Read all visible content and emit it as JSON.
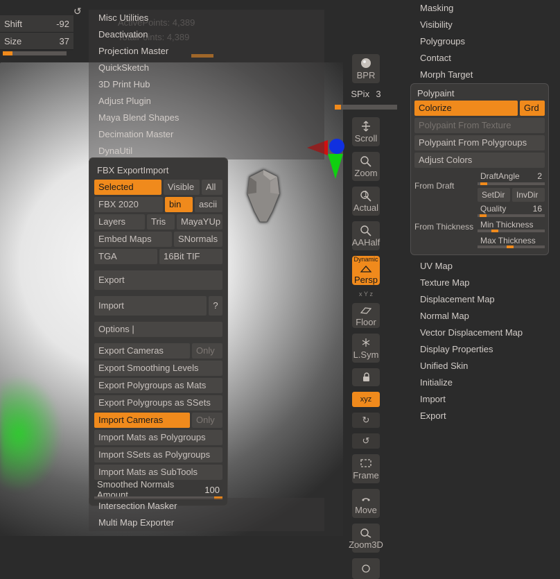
{
  "topleft": {
    "shift_label": "Shift",
    "shift_value": "-92",
    "size_label": "Size",
    "size_value": "37"
  },
  "stats": {
    "active_label": "ActivePoints:",
    "active_value": "4,389",
    "total_label": "TotalPoints:",
    "total_value": "4,389"
  },
  "plugins": {
    "misc": "Misc Utilities",
    "deact": "Deactivation",
    "proj": "Projection Master",
    "qs": "QuickSketch",
    "p3d": "3D Print Hub",
    "adj": "Adjust Plugin",
    "maya": "Maya Blend Shapes",
    "dec": "Decimation Master",
    "dyna": "DynaUtil",
    "fbx_title": "FBX ExportImport",
    "inter": "Intersection Masker",
    "mme": "Multi Map Exporter"
  },
  "fbx": {
    "selected": "Selected",
    "visible": "Visible",
    "all": "All",
    "ver": "FBX 2020",
    "bin": "bin",
    "ascii": "ascii",
    "layers": "Layers",
    "tris": "Tris",
    "mayayup": "MayaYUp",
    "embed": "Embed Maps",
    "snorm": "SNormals",
    "tga": "TGA",
    "tif": "16Bit TIF",
    "export": "Export",
    "import": "Import",
    "qmark": "?",
    "opts": "Options  |",
    "expcam": "Export Cameras",
    "only1": "Only",
    "expsl": "Export Smoothing Levels",
    "exppg": "Export Polygroups as Mats",
    "expss": "Export Polygroups as SSets",
    "impcam": "Import Cameras",
    "only2": "Only",
    "impmat": "Import Mats as Polygroups",
    "impss": "Import SSets as Polygroups",
    "impsub": "Import Mats as SubTools",
    "snamt_label": "Smoothed Normals Amount",
    "snamt_val": "100"
  },
  "svr": {
    "bpr": "BPR",
    "spix": "SPix",
    "spix_val": "3",
    "scroll": "Scroll",
    "zoom": "Zoom",
    "actual": "Actual",
    "aahalf": "AAHalf",
    "dynamic": "Dynamic",
    "persp": "Persp",
    "floor": "Floor",
    "lsym": "L.Sym",
    "xyz": "xyz",
    "frame": "Frame",
    "move": "Move",
    "zoom3d": "Zoom3D"
  },
  "right": {
    "masking": "Masking",
    "visibility": "Visibility",
    "polygroups": "Polygroups",
    "contact": "Contact",
    "morph": "Morph Target",
    "polypaint": "Polypaint",
    "colorize": "Colorize",
    "grd": "Grd",
    "pftex": "Polypaint From Texture",
    "pfpg": "Polypaint From Polygroups",
    "adjcol": "Adjust Colors",
    "from_draft": "From Draft",
    "draft_angle": "DraftAngle",
    "draft_angle_val": "2",
    "setdir": "SetDir",
    "invdir": "InvDir",
    "from_thick": "From Thickness",
    "quality": "Quality",
    "quality_val": "16",
    "minthk": "Min Thickness",
    "maxthk": "Max Thickness",
    "uvmap": "UV Map",
    "texmap": "Texture Map",
    "dispmap": "Displacement Map",
    "normmap": "Normal Map",
    "vdmap": "Vector Displacement Map",
    "dispprop": "Display Properties",
    "uskin": "Unified Skin",
    "init": "Initialize",
    "import": "Import",
    "export": "Export"
  }
}
